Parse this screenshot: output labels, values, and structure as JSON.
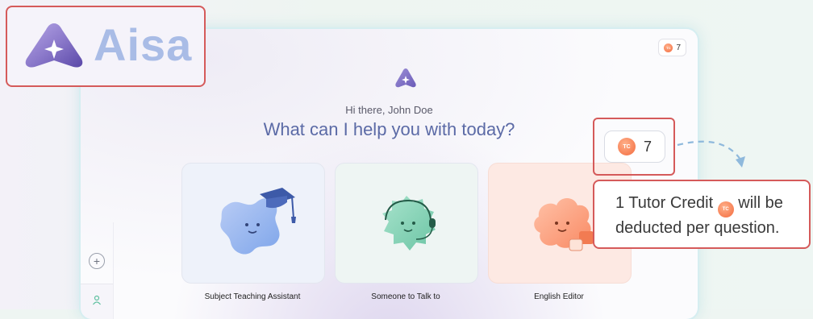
{
  "brand": {
    "name": "Aisa"
  },
  "credits": {
    "count": "7",
    "coin_label": "TC"
  },
  "greeting": "Hi there, John Doe",
  "headline": "What can I help you with today?",
  "cards": [
    {
      "label": "Subject Teaching Assistant"
    },
    {
      "label": "Someone to Talk to"
    },
    {
      "label": "English Editor"
    }
  ],
  "callout": {
    "line1_before": "1 Tutor Credit",
    "line1_after": "will be",
    "line2": "deducted per question."
  },
  "colors": {
    "accent_text": "#5b6aa6",
    "callout_border": "#d55a5a",
    "coin": "#f36b3e"
  }
}
